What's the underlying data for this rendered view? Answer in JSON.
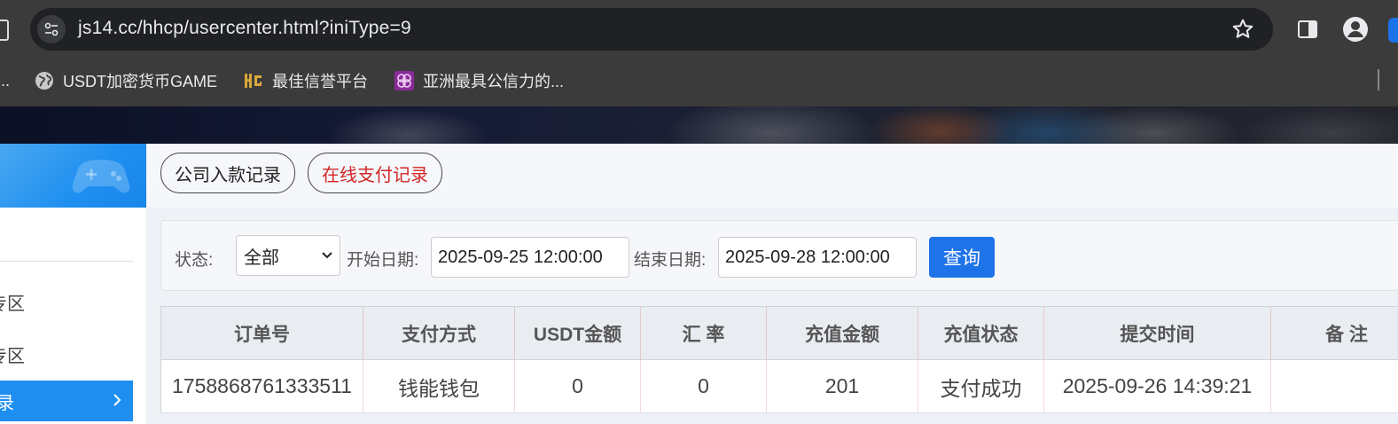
{
  "browser": {
    "url": "js14.cc/hhcp/usercenter.html?iniType=9",
    "bookmarks": [
      {
        "label": "...",
        "icon": "none"
      },
      {
        "label": "USDT加密货币GAME",
        "icon": "globe-icon"
      },
      {
        "label": "最佳信誉平台",
        "icon": "hg-logo-icon"
      },
      {
        "label": "亚洲最具公信力的...",
        "icon": "purple-knot-icon"
      }
    ]
  },
  "sidebar": {
    "items": [
      {
        "label": "专区"
      },
      {
        "label": "专区"
      },
      {
        "label": "录"
      }
    ]
  },
  "tabs": {
    "company_deposit": "公司入款记录",
    "online_payment": "在线支付记录"
  },
  "filter": {
    "status_label": "状态:",
    "status_value": "全部",
    "start_label": "开始日期:",
    "start_value": "2025-09-25 12:00:00",
    "end_label": "结束日期:",
    "end_value": "2025-09-28 12:00:00",
    "query_button": "查询"
  },
  "table": {
    "headers": [
      "订单号",
      "支付方式",
      "USDT金额",
      "汇 率",
      "充值金额",
      "充值状态",
      "提交时间",
      "备 注"
    ],
    "rows": [
      [
        "1758868761333511",
        "钱能钱包",
        "0",
        "0",
        "201",
        "支付成功",
        "2025-09-26 14:39:21",
        ""
      ]
    ]
  },
  "colors": {
    "accent": "#1e73e8",
    "sidebar_blue": "#1e8ff0",
    "active_tab_text": "#d32525"
  }
}
